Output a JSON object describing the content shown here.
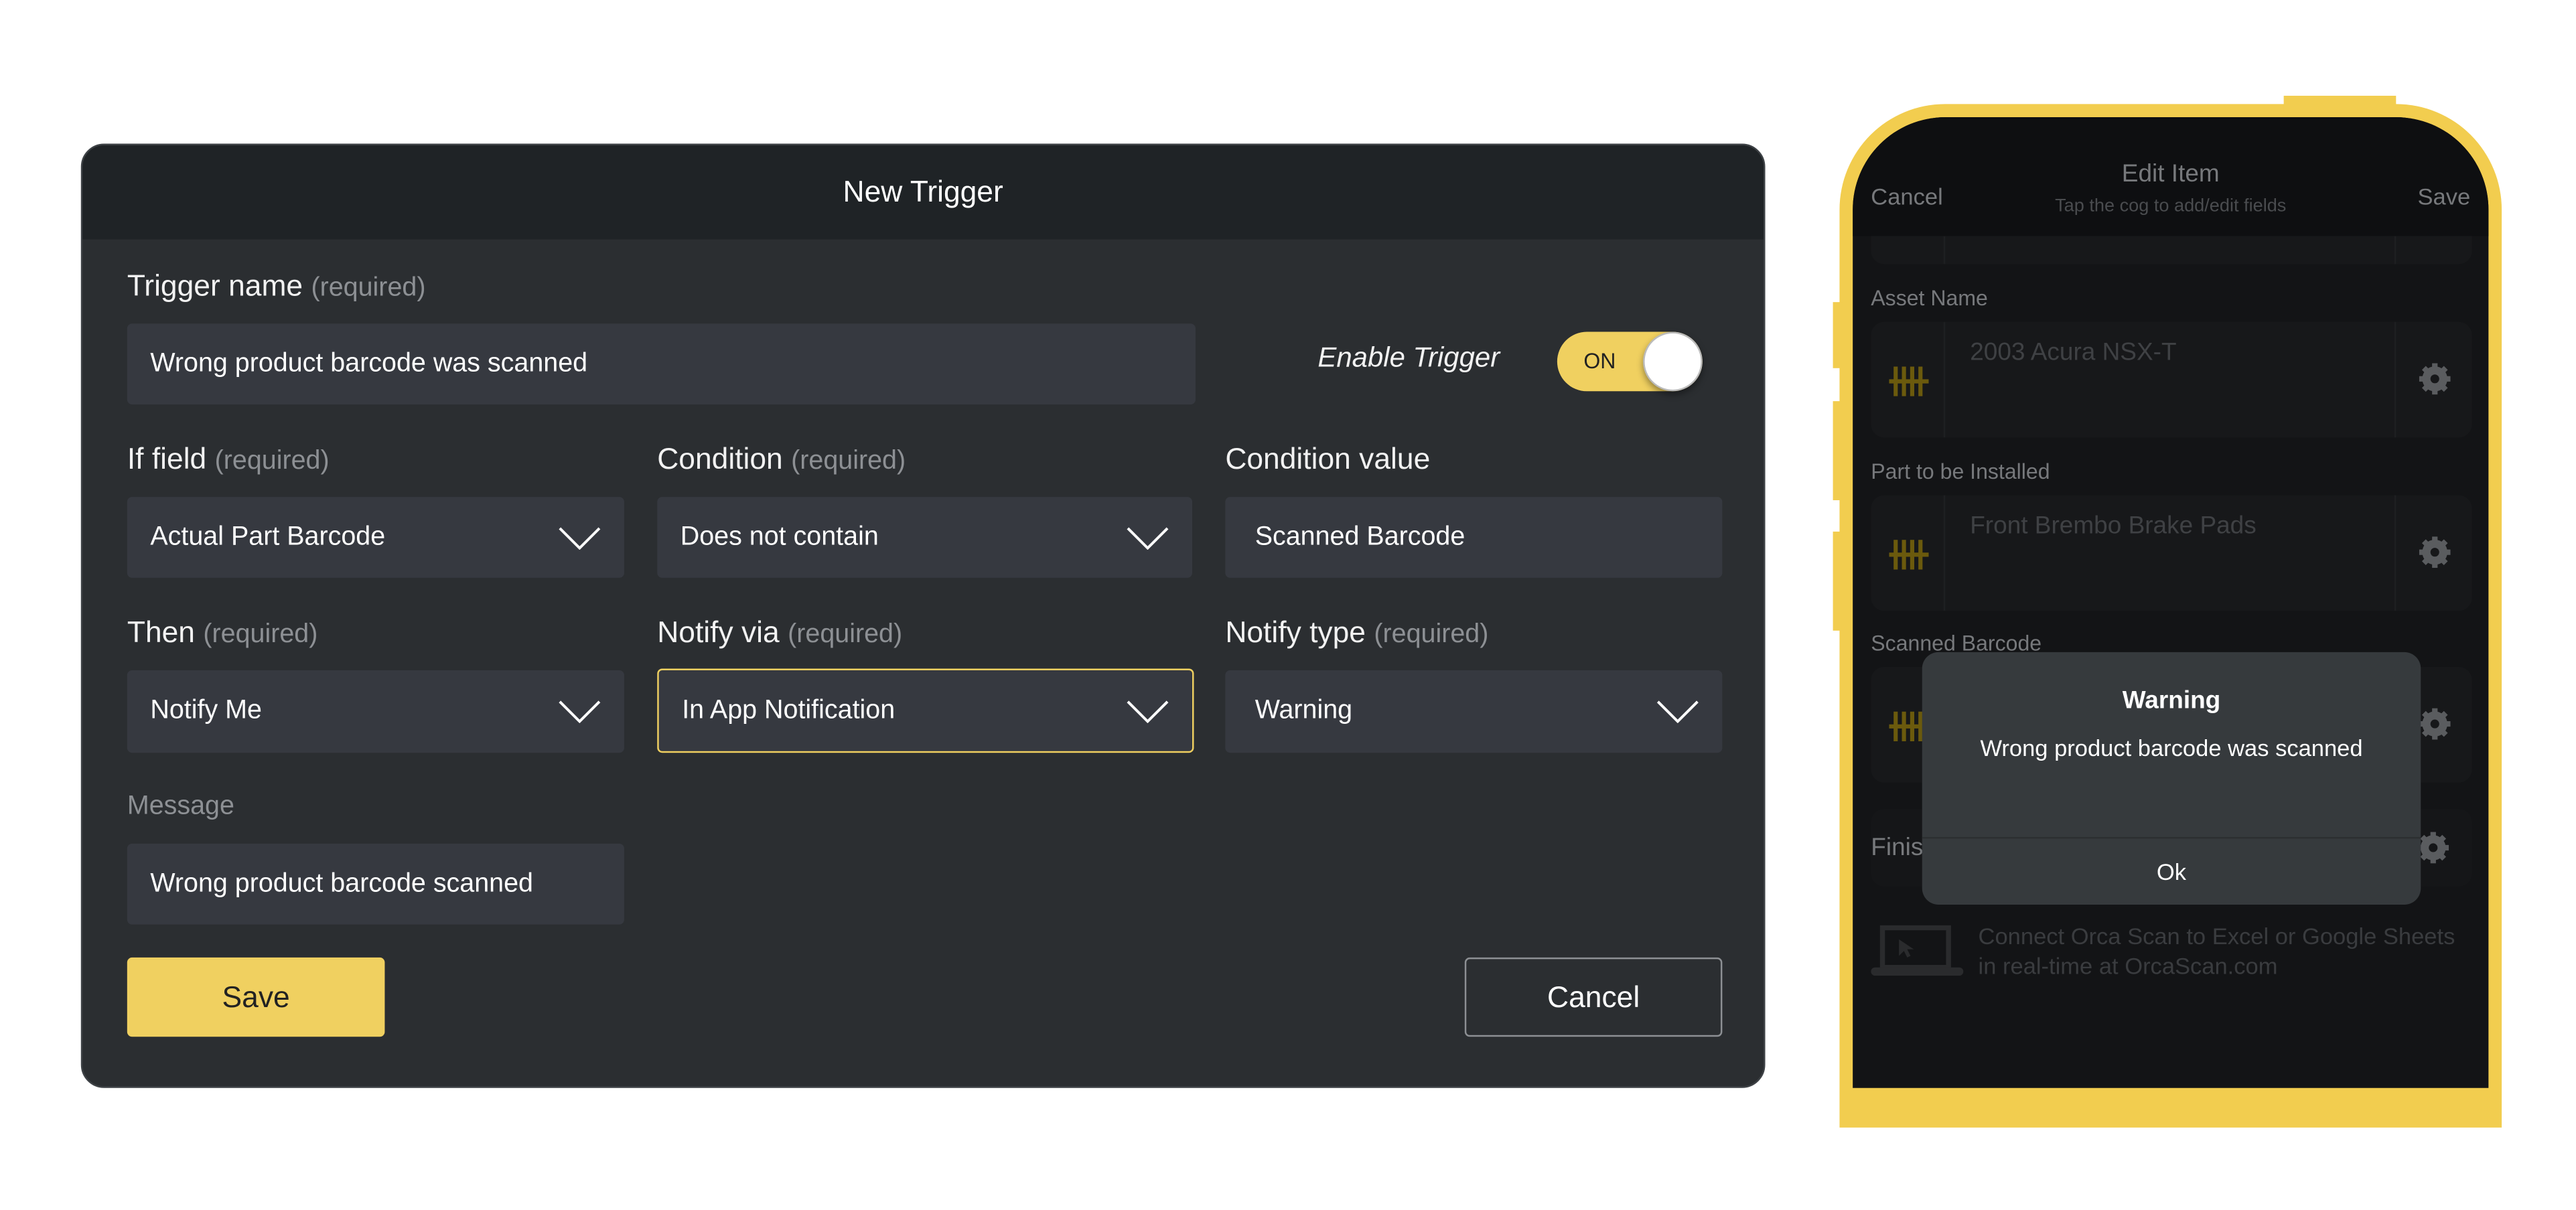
{
  "dialog": {
    "title": "New Trigger",
    "trigger_name": {
      "label": "Trigger name",
      "hint": "(required)",
      "value": "Wrong product barcode was scanned"
    },
    "enable": {
      "label": "Enable Trigger",
      "state": "ON"
    },
    "if_field": {
      "label": "If field",
      "hint": "(required)",
      "value": "Actual Part Barcode"
    },
    "condition": {
      "label": "Condition",
      "hint": "(required)",
      "value": "Does not contain"
    },
    "condition_value": {
      "label": "Condition value",
      "value": "Scanned Barcode"
    },
    "then": {
      "label": "Then",
      "hint": "(required)",
      "value": "Notify Me"
    },
    "notify_via": {
      "label": "Notify via",
      "hint": "(required)",
      "value": "In App Notification"
    },
    "notify_type": {
      "label": "Notify type",
      "hint": "(required)",
      "value": "Warning"
    },
    "message": {
      "label": "Message",
      "value": "Wrong product barcode scanned"
    },
    "save_label": "Save",
    "cancel_label": "Cancel"
  },
  "phone": {
    "cancel": "Cancel",
    "title": "Edit Item",
    "subtitle": "Tap the cog to add/edit fields",
    "save": "Save",
    "fields": [
      {
        "label": "Asset Name",
        "value": "2003 Acura NSX-T"
      },
      {
        "label": "Part to be Installed",
        "value": "Front Brembo Brake Pads"
      },
      {
        "label": "Scanned Barcode",
        "value": ""
      },
      {
        "label": "Finis",
        "value": ""
      }
    ],
    "promo_line1": "Connect Orca Scan to Excel or Google Sheets",
    "promo_line2": "in real-time at OrcaScan.com",
    "alert": {
      "title": "Warning",
      "message": "Wrong product barcode was scanned",
      "ok": "Ok"
    }
  },
  "colors": {
    "accent": "#f0d060",
    "frame": "#f2cd4f",
    "dialog_bg": "#2b2e31",
    "input_bg": "#363940"
  }
}
